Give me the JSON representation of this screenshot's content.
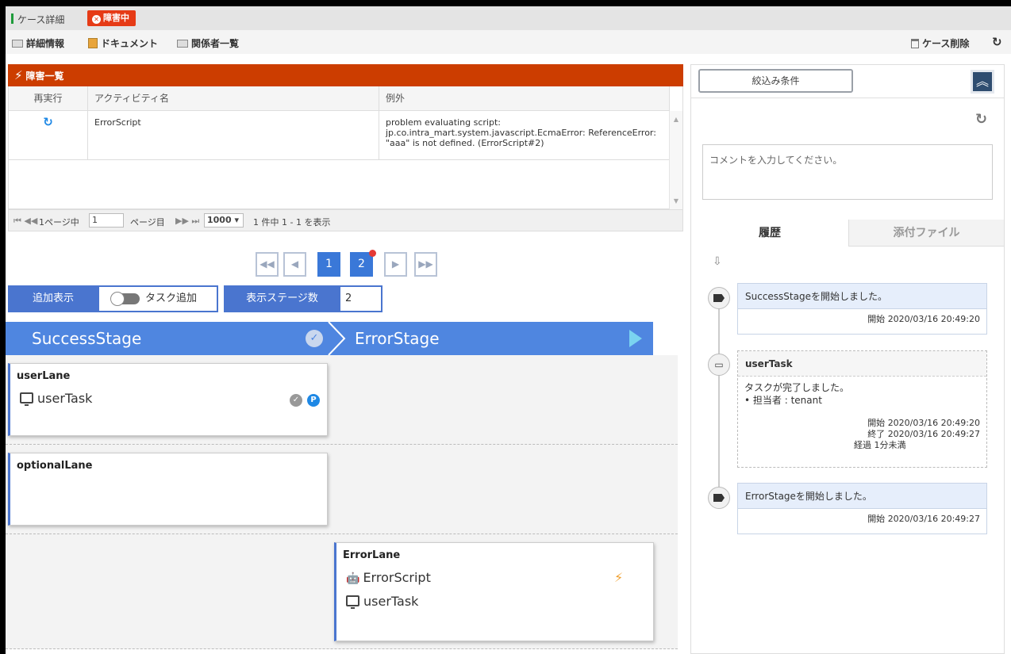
{
  "header": {
    "title": "ケース詳細",
    "status_badge": "障害中"
  },
  "toolbar": {
    "details": "詳細情報",
    "documents": "ドキュメント",
    "stakeholders": "関係者一覧",
    "delete_case": "ケース削除"
  },
  "error_panel": {
    "title": "障害一覧",
    "columns": [
      "再実行",
      "アクティビティ名",
      "例外"
    ],
    "rows": [
      {
        "activity": "ErrorScript",
        "exception": "problem evaluating script: jp.co.intra_mart.system.javascript.EcmaError: ReferenceError: \"aaa\" is not defined. (ErrorScript#2)"
      }
    ],
    "pager": {
      "prefix": "1ページ中",
      "page_value": "1",
      "suffix": "ページ目",
      "page_size": "1000",
      "summary": "1 件中 1 - 1 を表示"
    }
  },
  "stage_pager": {
    "pages": [
      "1",
      "2"
    ],
    "current": "1"
  },
  "controls": {
    "additional_label": "追加表示",
    "task_add_label": "タスク追加",
    "stage_count_label": "表示ステージ数",
    "stage_count_value": "2"
  },
  "stages": [
    {
      "name": "SuccessStage",
      "status": "completed"
    },
    {
      "name": "ErrorStage",
      "status": "active"
    }
  ],
  "lanes": {
    "user_lane": {
      "title": "userLane",
      "task": "userTask",
      "p_badge": "P"
    },
    "optional_lane": {
      "title": "optionalLane"
    },
    "error_lane": {
      "title": "ErrorLane",
      "script": "ErrorScript",
      "task": "userTask"
    }
  },
  "side_panel": {
    "filter_button": "絞込み条件",
    "comment_placeholder": "コメントを入力してください。",
    "tabs": [
      "履歴",
      "添付ファイル"
    ],
    "history": [
      {
        "type": "stage",
        "message": "SuccessStageを開始しました。",
        "start_label": "開始",
        "start": "2020/03/16 20:49:20"
      },
      {
        "type": "task",
        "title": "userTask",
        "message": "タスクが完了しました。",
        "assignee": "担当者 : tenant",
        "start_label": "開始",
        "start": "2020/03/16 20:49:20",
        "end_label": "終了",
        "end": "2020/03/16 20:49:27",
        "elapsed_label": "経過",
        "elapsed": "1分未満"
      },
      {
        "type": "stage",
        "message": "ErrorStageを開始しました。",
        "start_label": "開始",
        "start": "2020/03/16 20:49:27"
      }
    ]
  },
  "colors": {
    "error_red": "#cc3d00",
    "stage_blue": "#4f86e0",
    "accent_blue": "#3a78d8",
    "ok_green": "#1f9b3b"
  }
}
